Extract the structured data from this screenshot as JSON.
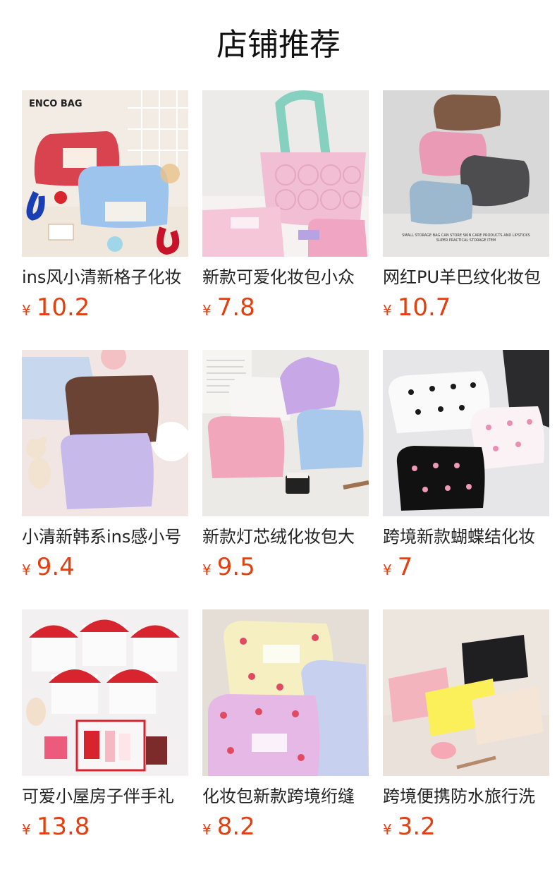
{
  "header": {
    "title": "店铺推荐"
  },
  "colors": {
    "price": "#e4400f"
  },
  "products": [
    {
      "name": "ins风小清新格子化妆",
      "currency": "¥",
      "price": "10.2",
      "brand_text": "ENCO BAG"
    },
    {
      "name": "新款可爱化妆包小众",
      "currency": "¥",
      "price": "7.8"
    },
    {
      "name": "网红PU羊巴纹化妆包",
      "currency": "¥",
      "price": "10.7",
      "caption_line1": "SMALL STORAGE BAG CAN STORE SKIN CARE PRODUCTS AND LIPSTICKS",
      "caption_line2": "SUPER PRACTICAL STORAGE ITEM"
    },
    {
      "name": "小清新韩系ins感小号",
      "currency": "¥",
      "price": "9.4"
    },
    {
      "name": "新款灯芯绒化妆包大",
      "currency": "¥",
      "price": "9.5"
    },
    {
      "name": "跨境新款蝴蝶结化妆",
      "currency": "¥",
      "price": "7"
    },
    {
      "name": "可爱小屋房子伴手礼",
      "currency": "¥",
      "price": "13.8"
    },
    {
      "name": "化妆包新款跨境绗缝",
      "currency": "¥",
      "price": "8.2"
    },
    {
      "name": "跨境便携防水旅行洗",
      "currency": "¥",
      "price": "3.2"
    }
  ]
}
